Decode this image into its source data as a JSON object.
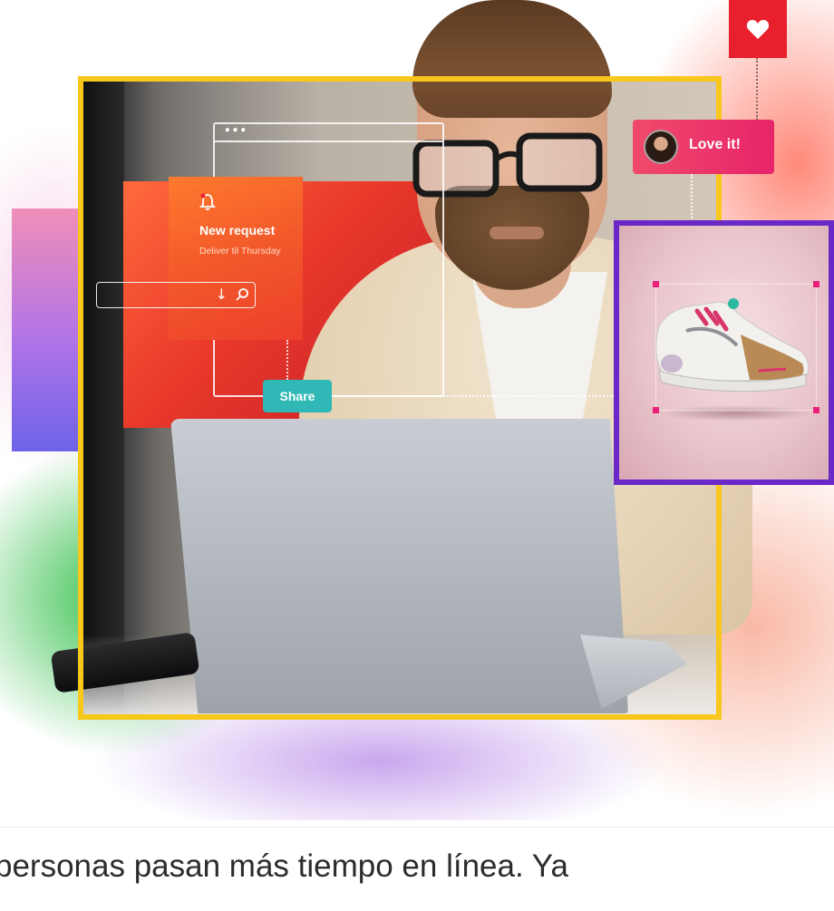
{
  "notification": {
    "title": "New request",
    "subtitle": "Deliver til Thursday"
  },
  "search": {
    "arrow_glyph": "↓"
  },
  "share_button": {
    "label": "Share"
  },
  "reaction": {
    "label": "Love it!"
  },
  "article": {
    "text_line": "personas pasan más tiempo en línea. Ya"
  },
  "colors": {
    "frame_yellow": "#f8c71b",
    "product_frame_purple": "#6a28c8",
    "share_teal": "#2fb8b5",
    "heart_red": "#e8202e",
    "love_pink": "#e8246a",
    "notification_orange": "#f2582a"
  },
  "icons": [
    "bell-icon",
    "search-icon",
    "heart-icon",
    "avatar",
    "sneaker-image"
  ]
}
